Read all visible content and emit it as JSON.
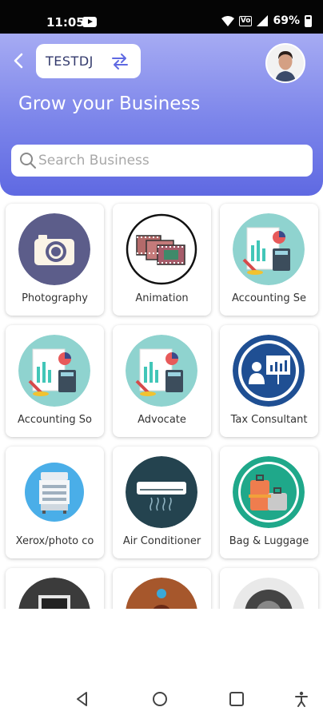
{
  "status_bar": {
    "time": "11:05",
    "battery": "69%",
    "network": "Vo"
  },
  "header": {
    "tenant_name": "TESTDJ",
    "headline": "Grow your Business",
    "search_placeholder": "Search Business"
  },
  "categories": [
    {
      "label": "Photography",
      "icon": "camera-icon"
    },
    {
      "label": "Animation",
      "icon": "film-strip-icon"
    },
    {
      "label": "Accounting Se",
      "icon": "accounting-icon"
    },
    {
      "label": "Accounting So",
      "icon": "accounting-icon"
    },
    {
      "label": "Advocate",
      "icon": "accounting-icon"
    },
    {
      "label": "Tax Consultant",
      "icon": "presentation-icon"
    },
    {
      "label": "Xerox/photo co",
      "icon": "printer-icon"
    },
    {
      "label": "Air Conditioner",
      "icon": "air-conditioner-icon"
    },
    {
      "label": "Bag & Luggage",
      "icon": "luggage-icon"
    },
    {
      "label": "",
      "icon": "window-icon"
    },
    {
      "label": "",
      "icon": "worker-icon"
    },
    {
      "label": "",
      "icon": "tyre-icon"
    }
  ],
  "colors": {
    "header_top": "#a6abf3",
    "header_bottom": "#5f69e2",
    "accent": "#333a6c"
  }
}
